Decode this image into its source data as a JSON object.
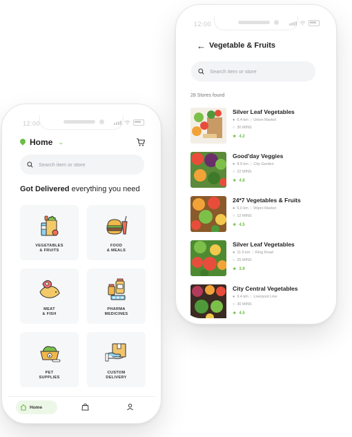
{
  "colors": {
    "accent": "#6cbd45",
    "tile_bg": "#f5f7f8",
    "search_bg": "#f3f4f6"
  },
  "left_phone": {
    "status_time": "12:00",
    "location": "Home",
    "search_placeholder": "Search item or store",
    "headline_bold": "Got Delivered",
    "headline_rest": " everything you need",
    "categories": [
      {
        "label": "VEGETABLES\n& FRUITS",
        "icon": "vegetables-bag-icon"
      },
      {
        "label": "FOOD\n& MEALS",
        "icon": "burger-icon"
      },
      {
        "label": "MEAT\n& FISH",
        "icon": "meat-fish-icon"
      },
      {
        "label": "PHARMA\nMEDICINES",
        "icon": "medicine-bottle-icon"
      },
      {
        "label": "PET\nSUPPLIES",
        "icon": "pet-bowl-icon"
      },
      {
        "label": "CUSTOM\nDELIVERY",
        "icon": "package-delivery-icon"
      }
    ],
    "nav": {
      "home_label": "Home"
    }
  },
  "right_phone": {
    "status_time": "12:00",
    "title": "Vegetable & Fruits",
    "search_placeholder": "Search item or store",
    "count_text": "28 Stores found",
    "stores": [
      {
        "name": "Silver Leaf Vegetables",
        "distance": "6.4 km",
        "area": "Union Market",
        "time": "30 MINS",
        "rating": "4.2"
      },
      {
        "name": "Good'day Veggies",
        "distance": "8.9 km",
        "area": "City Garden",
        "time": "22 MINS",
        "rating": "4.8"
      },
      {
        "name": "24*7 Vegetables & Fruits",
        "distance": "5.0 km",
        "area": "Wipro Market",
        "time": "12 MINS",
        "rating": "4.5"
      },
      {
        "name": "Silver Leaf Vegetables",
        "distance": "11.5 km",
        "area": "Ring Road",
        "time": "25 MINS",
        "rating": "3.9"
      },
      {
        "name": "City Central Vegetables",
        "distance": "9.4 km",
        "area": "Liverpool Line",
        "time": "30 MINS",
        "rating": "4.5"
      }
    ]
  }
}
